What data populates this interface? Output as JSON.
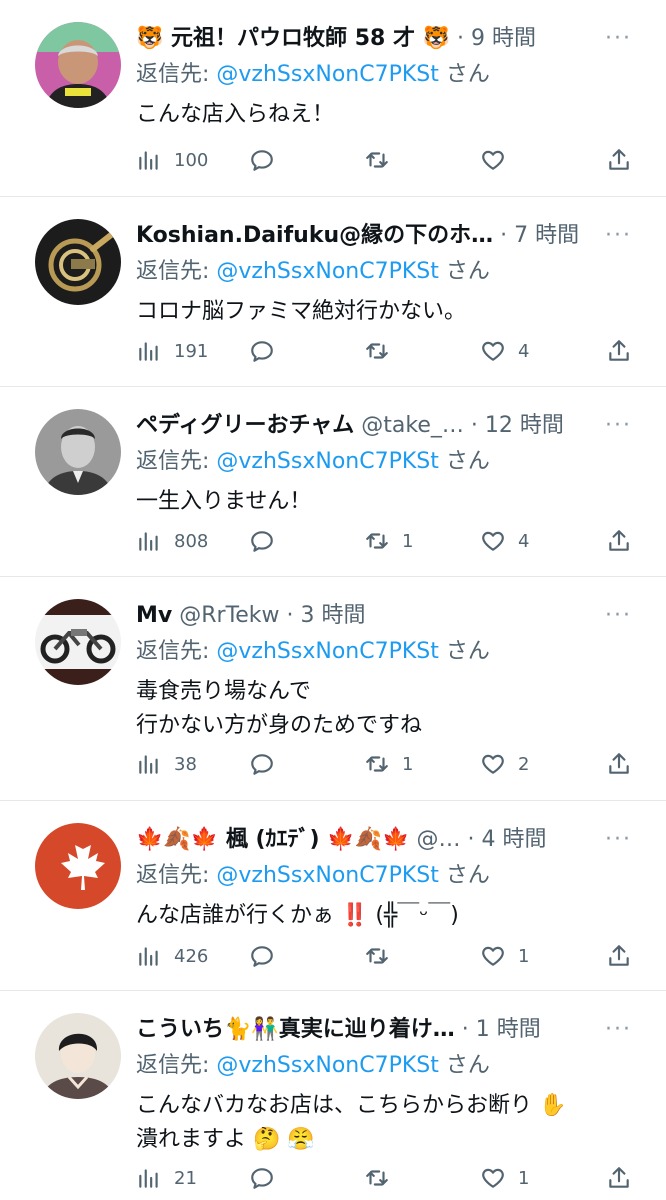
{
  "reply_prefix": "返信先: ",
  "reply_suffix": " さん",
  "icons": {
    "views": "bar-chart-icon",
    "reply": "speech-bubble-icon",
    "retweet": "retweet-arrows-icon",
    "like": "heart-icon",
    "share": "share-up-arrow-icon",
    "more": "more-dots-icon"
  },
  "colors": {
    "mention": "#1d9bf0",
    "muted": "#536471",
    "divider": "#e6e9ec"
  },
  "tweets": [
    {
      "name": "🐯 元祖！パウロ牧師 58 才 🐯",
      "handle": "",
      "sep": "·",
      "time": "9 時間",
      "mention": "@vzhSsxNonC7PKSt",
      "text": "こんな店入らねえ！",
      "views": "100",
      "replies": "",
      "retweets": "",
      "likes": ""
    },
    {
      "name": "Koshian.Daifuku@縁の下のホ…",
      "handle": "",
      "sep": "·",
      "time": "7 時間",
      "mention": "@vzhSsxNonC7PKSt",
      "text": "コロナ脳ファミマ絶対行かない。",
      "views": "191",
      "replies": "",
      "retweets": "",
      "likes": "4"
    },
    {
      "name": "ペディグリーおチャム",
      "handle": "@take_…",
      "sep": "·",
      "time": "12 時間",
      "mention": "@vzhSsxNonC7PKSt",
      "text": "一生入りません！",
      "views": "808",
      "replies": "",
      "retweets": "1",
      "likes": "4"
    },
    {
      "name": "Mv",
      "handle": "@RrTekw",
      "sep": "·",
      "time": "3 時間",
      "mention": "@vzhSsxNonC7PKSt",
      "text": "毒食売り場なんで\n行かない方が身のためですね",
      "views": "38",
      "replies": "",
      "retweets": "1",
      "likes": "2"
    },
    {
      "name": "🍁🍂🍁 楓 (ｶｴﾃﾞ) 🍁🍂🍁",
      "handle": "@…",
      "sep": "·",
      "time": "4 時間",
      "mention": "@vzhSsxNonC7PKSt",
      "text": "んな店誰が行くかぁ ‼️ (╬￣ᵕ￣)",
      "views": "426",
      "replies": "",
      "retweets": "",
      "likes": "1"
    },
    {
      "name": "こういち🐈👫真実に辿り着け…",
      "handle": "",
      "sep": "·",
      "time": "1 時間",
      "mention": "@vzhSsxNonC7PKSt",
      "text": "こんなバカなお店は、こちらからお断り ✋\n潰れますよ 🤔 😤",
      "views": "21",
      "replies": "",
      "retweets": "",
      "likes": "1"
    }
  ]
}
